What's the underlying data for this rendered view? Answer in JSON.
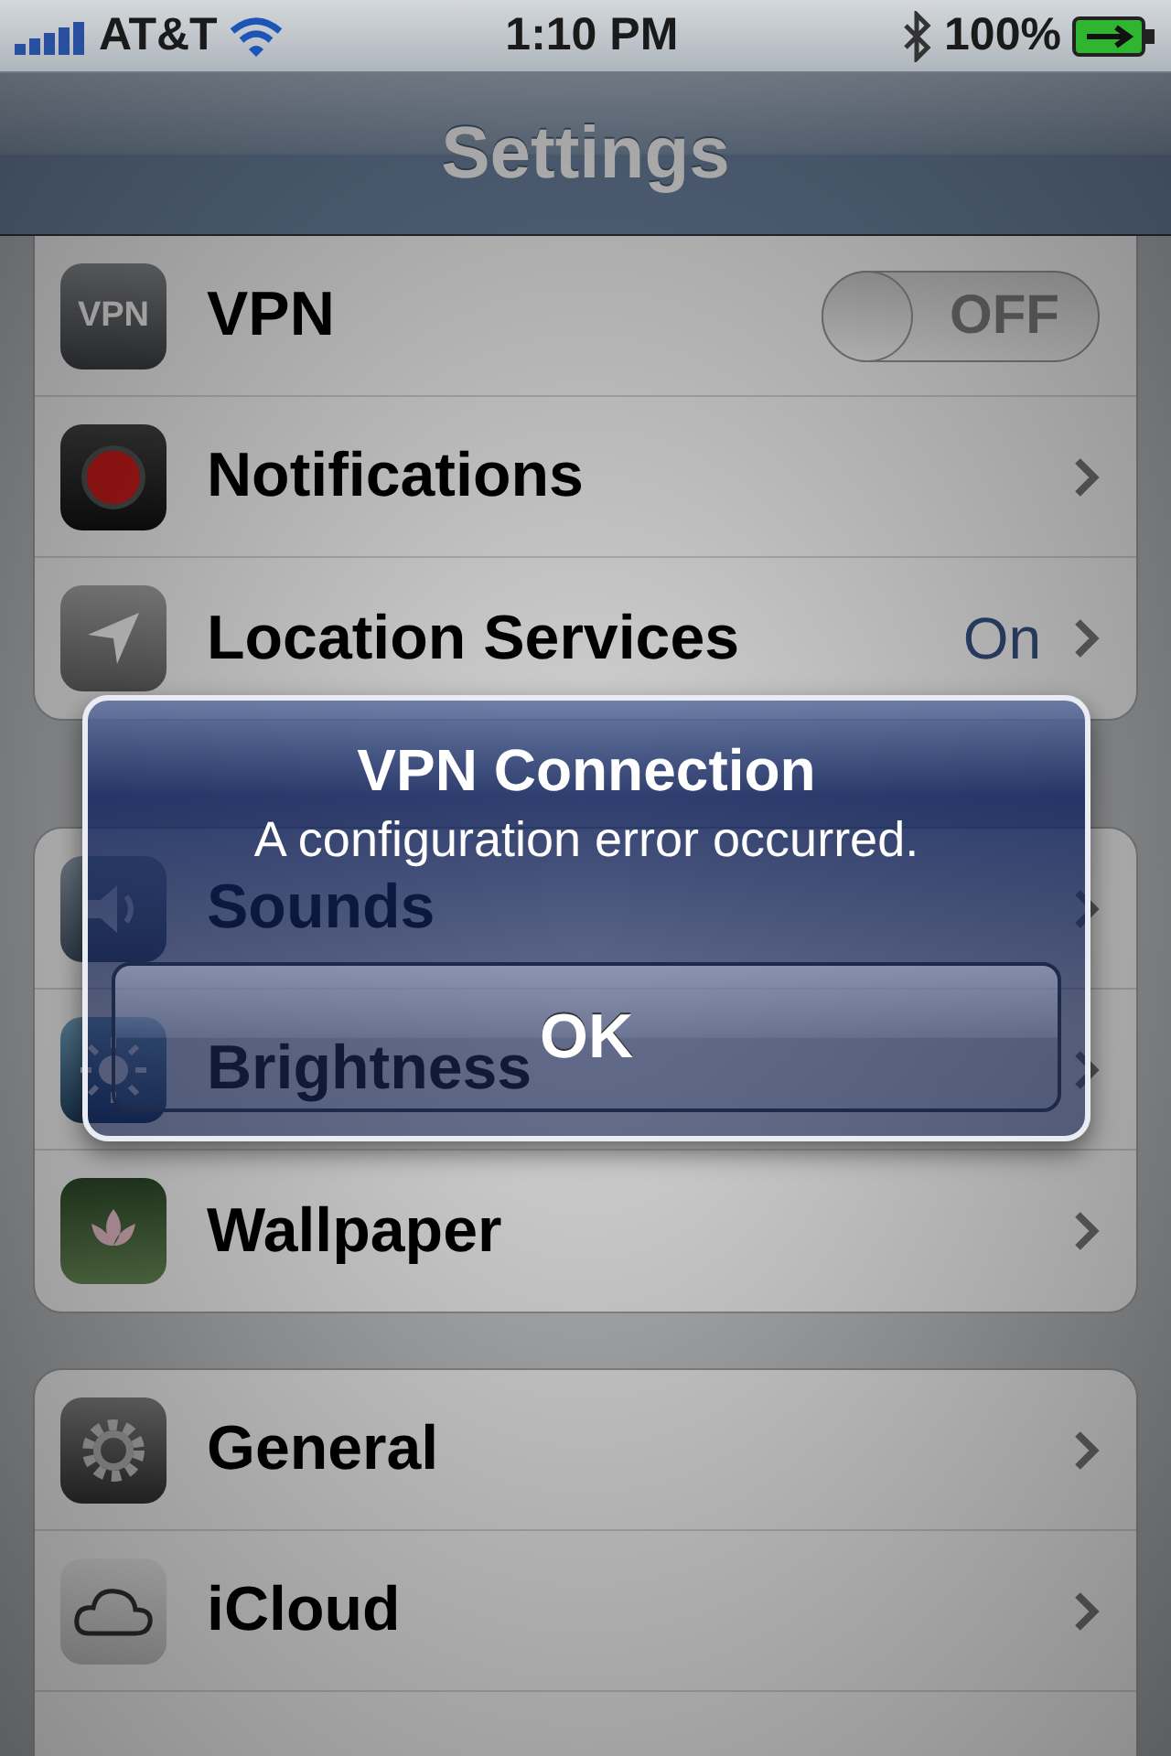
{
  "status_bar": {
    "carrier": "AT&T",
    "time": "1:10 PM",
    "battery": "100%"
  },
  "nav_bar": {
    "title": "Settings"
  },
  "groups": [
    {
      "rows": [
        {
          "kind": "toggle",
          "label": "VPN",
          "icon_text": "VPN",
          "switch": {
            "on": false,
            "label": "OFF"
          }
        },
        {
          "kind": "link",
          "label": "Notifications"
        },
        {
          "kind": "link",
          "label": "Location Services",
          "value": "On"
        }
      ]
    },
    {
      "rows": [
        {
          "kind": "link",
          "label": "Sounds"
        },
        {
          "kind": "link",
          "label": "Brightness"
        },
        {
          "kind": "link",
          "label": "Wallpaper"
        }
      ]
    },
    {
      "rows": [
        {
          "kind": "link",
          "label": "General"
        },
        {
          "kind": "link",
          "label": "iCloud"
        }
      ]
    }
  ],
  "alert": {
    "title": "VPN Connection",
    "message": "A configuration error occurred.",
    "button": "OK"
  }
}
